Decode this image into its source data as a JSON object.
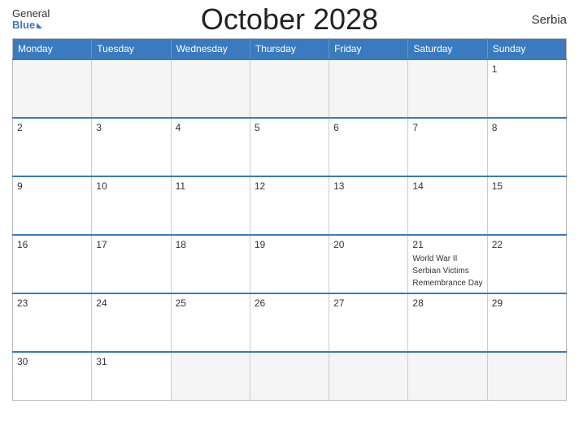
{
  "header": {
    "logo_general": "General",
    "logo_blue": "Blue",
    "title": "October 2028",
    "country": "Serbia"
  },
  "days_of_week": [
    "Monday",
    "Tuesday",
    "Wednesday",
    "Thursday",
    "Friday",
    "Saturday",
    "Sunday"
  ],
  "weeks": [
    [
      {
        "date": "",
        "empty": true
      },
      {
        "date": "",
        "empty": true
      },
      {
        "date": "",
        "empty": true
      },
      {
        "date": "",
        "empty": true
      },
      {
        "date": "",
        "empty": true
      },
      {
        "date": "",
        "empty": true
      },
      {
        "date": "1",
        "empty": false,
        "event": ""
      }
    ],
    [
      {
        "date": "2",
        "empty": false,
        "event": ""
      },
      {
        "date": "3",
        "empty": false,
        "event": ""
      },
      {
        "date": "4",
        "empty": false,
        "event": ""
      },
      {
        "date": "5",
        "empty": false,
        "event": ""
      },
      {
        "date": "6",
        "empty": false,
        "event": ""
      },
      {
        "date": "7",
        "empty": false,
        "event": ""
      },
      {
        "date": "8",
        "empty": false,
        "event": ""
      }
    ],
    [
      {
        "date": "9",
        "empty": false,
        "event": ""
      },
      {
        "date": "10",
        "empty": false,
        "event": ""
      },
      {
        "date": "11",
        "empty": false,
        "event": ""
      },
      {
        "date": "12",
        "empty": false,
        "event": ""
      },
      {
        "date": "13",
        "empty": false,
        "event": ""
      },
      {
        "date": "14",
        "empty": false,
        "event": ""
      },
      {
        "date": "15",
        "empty": false,
        "event": ""
      }
    ],
    [
      {
        "date": "16",
        "empty": false,
        "event": ""
      },
      {
        "date": "17",
        "empty": false,
        "event": ""
      },
      {
        "date": "18",
        "empty": false,
        "event": ""
      },
      {
        "date": "19",
        "empty": false,
        "event": ""
      },
      {
        "date": "20",
        "empty": false,
        "event": ""
      },
      {
        "date": "21",
        "empty": false,
        "event": "World War II Serbian Victims Remembrance Day"
      },
      {
        "date": "22",
        "empty": false,
        "event": ""
      }
    ],
    [
      {
        "date": "23",
        "empty": false,
        "event": ""
      },
      {
        "date": "24",
        "empty": false,
        "event": ""
      },
      {
        "date": "25",
        "empty": false,
        "event": ""
      },
      {
        "date": "26",
        "empty": false,
        "event": ""
      },
      {
        "date": "27",
        "empty": false,
        "event": ""
      },
      {
        "date": "28",
        "empty": false,
        "event": ""
      },
      {
        "date": "29",
        "empty": false,
        "event": ""
      }
    ],
    [
      {
        "date": "30",
        "empty": false,
        "event": ""
      },
      {
        "date": "31",
        "empty": false,
        "event": ""
      },
      {
        "date": "",
        "empty": true
      },
      {
        "date": "",
        "empty": true
      },
      {
        "date": "",
        "empty": true
      },
      {
        "date": "",
        "empty": true
      },
      {
        "date": "",
        "empty": true
      }
    ]
  ]
}
